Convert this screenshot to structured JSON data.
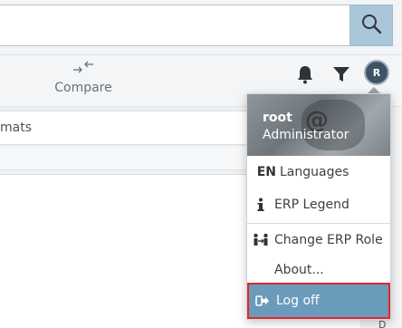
{
  "search": {
    "value": "",
    "placeholder": ""
  },
  "toolbar": {
    "compare_label": "Compare"
  },
  "user": {
    "initial": "R",
    "name": "root",
    "role": "Administrator"
  },
  "background": {
    "tab_text": "mats"
  },
  "menu": {
    "languages": {
      "prefix": "EN",
      "label": "Languages"
    },
    "legend": {
      "label": "ERP Legend"
    },
    "change_role": {
      "label": "Change ERP Role"
    },
    "about": {
      "label": "About..."
    },
    "logoff": {
      "label": "Log off"
    }
  },
  "corner_label": "D",
  "colors": {
    "search_button": "#a9c7d8",
    "logoff_bg": "#6a9bbb",
    "highlight_border": "#e2262c"
  }
}
